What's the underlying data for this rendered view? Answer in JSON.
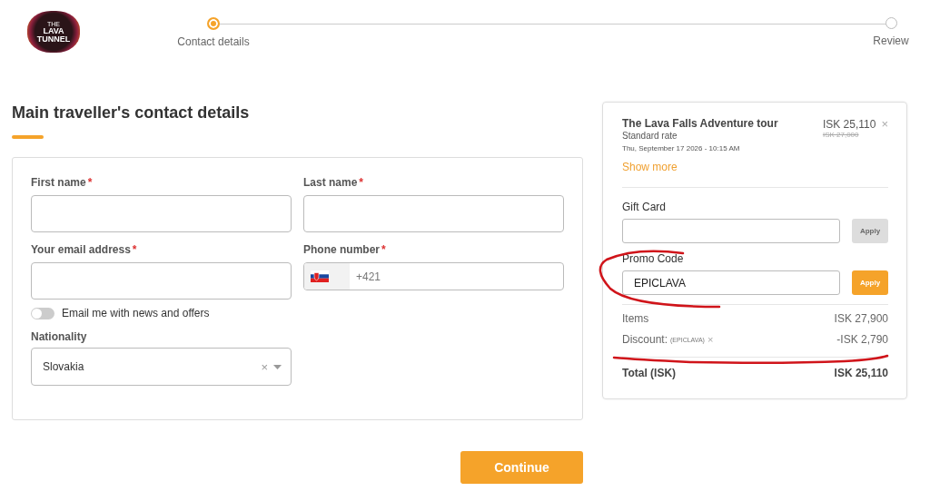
{
  "logo": {
    "lines": [
      "THE",
      "LAVA",
      "TUNNEL"
    ]
  },
  "steps": [
    {
      "label": "Contact details",
      "selected": true
    },
    {
      "label": "Review",
      "selected": false
    }
  ],
  "heading": "Main traveller's contact details",
  "required_mark": "*",
  "form": {
    "first_name": {
      "label": "First name",
      "required": true
    },
    "last_name": {
      "label": "Last name",
      "required": true
    },
    "email": {
      "label": "Your email address",
      "required": true
    },
    "phone": {
      "label": "Phone number",
      "required": true,
      "placeholder": "+421"
    },
    "newsletter": {
      "label": "Email me with news and offers",
      "on": false
    },
    "nationality": {
      "label": "Nationality",
      "value": "Slovakia",
      "clear": "×"
    }
  },
  "summary": {
    "tour": {
      "name": "The Lava Falls Adventure tour",
      "rate": "Standard rate",
      "date": "Thu, September 17 2026 - 10:15 AM",
      "price": "ISK 25,110",
      "old_price": "ISK 27,000",
      "remove": "×"
    },
    "show_more": "Show more",
    "gift_card": {
      "label": "Gift Card",
      "button": "Apply",
      "disabled": true
    },
    "promo_code": {
      "label": "Promo Code",
      "value": "EPICLAVA",
      "button": "Apply",
      "disabled": false
    },
    "items": {
      "label": "Items",
      "amount": "ISK 27,900"
    },
    "discount": {
      "label": "Discount:",
      "code": "(EPICLAVA)",
      "remove": "×",
      "amount": "-ISK 2,790"
    },
    "total": {
      "label": "Total (ISK)",
      "amount": "ISK 25,110"
    }
  },
  "continue": "Continue"
}
